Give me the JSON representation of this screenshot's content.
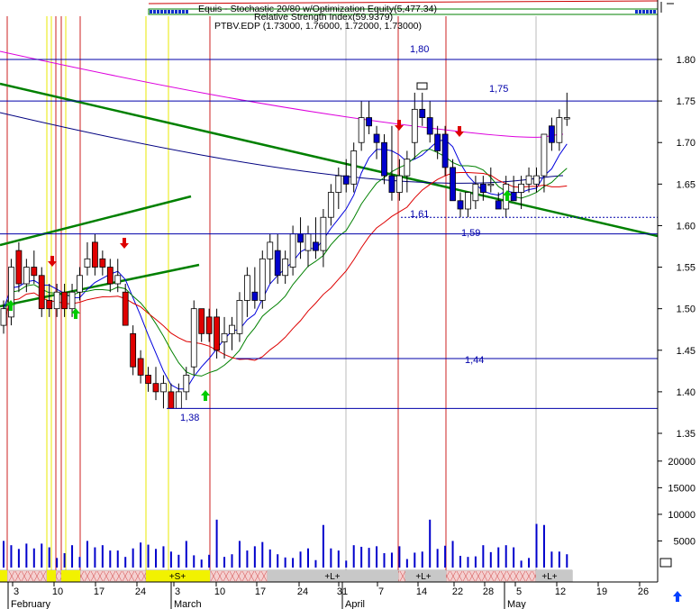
{
  "header": {
    "line1": "Equis - Stochastic 20/80 w/Optimization Equity(5,477.34)",
    "line2": "Relative Strength Index(59.9379)",
    "line3": "PTBV.EDP (1.73000, 1.76000, 1.72000, 1.73000)"
  },
  "colors": {
    "up_candle": "#ffffff",
    "down_candle_red": "#e00000",
    "down_candle_blue": "#0000cc",
    "volume": "#0000cc",
    "trendline": "#008000",
    "level": "#0000aa",
    "ma_magenta": "#dd00dd",
    "ma_navy": "#000080",
    "ma_green": "#008000",
    "ma_red": "#dd0000",
    "signal_line": "#cc0000",
    "buy_arrow": "#00cc00",
    "sell_arrow": "#dd0000"
  },
  "chart_data": {
    "type": "candlestick",
    "price_axis": {
      "ticks": [
        "1.80",
        "1.75",
        "1.70",
        "1.65",
        "1.60",
        "1.55",
        "1.50",
        "1.45",
        "1.40",
        "1.35"
      ],
      "ylim": [
        1.318,
        1.84
      ]
    },
    "volume_axis": {
      "ticks": [
        "20000",
        "15000",
        "10000",
        "5000"
      ],
      "ylim": [
        0,
        22000
      ]
    },
    "x_axis": {
      "tick_labels": [
        "3",
        "10",
        "17",
        "24",
        "3",
        "10",
        "17",
        "24",
        "31",
        "7",
        "14",
        "22",
        "28",
        "5",
        "12",
        "19",
        "26"
      ],
      "month_labels": [
        "February",
        "March",
        "April",
        "May"
      ]
    },
    "levels": [
      {
        "label": "1,80",
        "value": 1.8
      },
      {
        "label": "1,75",
        "value": 1.75
      },
      {
        "label": "1,61",
        "value": 1.61
      },
      {
        "label": "1,59",
        "value": 1.59
      },
      {
        "label": "1,44",
        "value": 1.44
      },
      {
        "label": "1,38",
        "value": 1.38
      }
    ],
    "candles": [
      {
        "o": 1.48,
        "h": 1.51,
        "l": 1.47,
        "c": 1.5
      },
      {
        "o": 1.49,
        "h": 1.56,
        "l": 1.48,
        "c": 1.55
      },
      {
        "o": 1.57,
        "h": 1.58,
        "l": 1.52,
        "c": 1.53
      },
      {
        "o": 1.53,
        "h": 1.56,
        "l": 1.52,
        "c": 1.55
      },
      {
        "o": 1.55,
        "h": 1.57,
        "l": 1.53,
        "c": 1.54
      },
      {
        "o": 1.54,
        "h": 1.55,
        "l": 1.49,
        "c": 1.5
      },
      {
        "o": 1.51,
        "h": 1.53,
        "l": 1.49,
        "c": 1.5
      },
      {
        "o": 1.5,
        "h": 1.53,
        "l": 1.49,
        "c": 1.52
      },
      {
        "o": 1.52,
        "h": 1.53,
        "l": 1.49,
        "c": 1.5
      },
      {
        "o": 1.5,
        "h": 1.53,
        "l": 1.49,
        "c": 1.52
      },
      {
        "o": 1.52,
        "h": 1.55,
        "l": 1.51,
        "c": 1.54
      },
      {
        "o": 1.55,
        "h": 1.58,
        "l": 1.54,
        "c": 1.56
      },
      {
        "o": 1.58,
        "h": 1.59,
        "l": 1.54,
        "c": 1.55
      },
      {
        "o": 1.56,
        "h": 1.57,
        "l": 1.54,
        "c": 1.55
      },
      {
        "o": 1.55,
        "h": 1.56,
        "l": 1.52,
        "c": 1.53
      },
      {
        "o": 1.53,
        "h": 1.56,
        "l": 1.52,
        "c": 1.54
      },
      {
        "o": 1.52,
        "h": 1.53,
        "l": 1.48,
        "c": 1.48
      },
      {
        "o": 1.47,
        "h": 1.48,
        "l": 1.42,
        "c": 1.43
      },
      {
        "o": 1.44,
        "h": 1.45,
        "l": 1.41,
        "c": 1.42
      },
      {
        "o": 1.42,
        "h": 1.43,
        "l": 1.4,
        "c": 1.41
      },
      {
        "o": 1.41,
        "h": 1.43,
        "l": 1.39,
        "c": 1.4
      },
      {
        "o": 1.4,
        "h": 1.42,
        "l": 1.38,
        "c": 1.41
      },
      {
        "o": 1.4,
        "h": 1.41,
        "l": 1.38,
        "c": 1.38
      },
      {
        "o": 1.38,
        "h": 1.41,
        "l": 1.38,
        "c": 1.4
      },
      {
        "o": 1.4,
        "h": 1.43,
        "l": 1.39,
        "c": 1.42
      },
      {
        "o": 1.43,
        "h": 1.51,
        "l": 1.42,
        "c": 1.5
      },
      {
        "o": 1.5,
        "h": 1.5,
        "l": 1.46,
        "c": 1.47
      },
      {
        "o": 1.49,
        "h": 1.5,
        "l": 1.46,
        "c": 1.47
      },
      {
        "o": 1.49,
        "h": 1.5,
        "l": 1.44,
        "c": 1.45
      },
      {
        "o": 1.46,
        "h": 1.49,
        "l": 1.44,
        "c": 1.47
      },
      {
        "o": 1.47,
        "h": 1.49,
        "l": 1.45,
        "c": 1.48
      },
      {
        "o": 1.47,
        "h": 1.52,
        "l": 1.46,
        "c": 1.51
      },
      {
        "o": 1.51,
        "h": 1.55,
        "l": 1.49,
        "c": 1.54
      },
      {
        "o": 1.52,
        "h": 1.55,
        "l": 1.5,
        "c": 1.51
      },
      {
        "o": 1.51,
        "h": 1.57,
        "l": 1.5,
        "c": 1.56
      },
      {
        "o": 1.56,
        "h": 1.59,
        "l": 1.53,
        "c": 1.58
      },
      {
        "o": 1.57,
        "h": 1.59,
        "l": 1.53,
        "c": 1.54
      },
      {
        "o": 1.54,
        "h": 1.57,
        "l": 1.53,
        "c": 1.56
      },
      {
        "o": 1.55,
        "h": 1.6,
        "l": 1.54,
        "c": 1.59
      },
      {
        "o": 1.59,
        "h": 1.61,
        "l": 1.56,
        "c": 1.58
      },
      {
        "o": 1.57,
        "h": 1.6,
        "l": 1.55,
        "c": 1.59
      },
      {
        "o": 1.58,
        "h": 1.61,
        "l": 1.56,
        "c": 1.57
      },
      {
        "o": 1.57,
        "h": 1.62,
        "l": 1.55,
        "c": 1.61
      },
      {
        "o": 1.61,
        "h": 1.65,
        "l": 1.6,
        "c": 1.64
      },
      {
        "o": 1.64,
        "h": 1.67,
        "l": 1.62,
        "c": 1.66
      },
      {
        "o": 1.66,
        "h": 1.68,
        "l": 1.64,
        "c": 1.65
      },
      {
        "o": 1.65,
        "h": 1.7,
        "l": 1.64,
        "c": 1.69
      },
      {
        "o": 1.7,
        "h": 1.75,
        "l": 1.69,
        "c": 1.73
      },
      {
        "o": 1.73,
        "h": 1.75,
        "l": 1.71,
        "c": 1.72
      },
      {
        "o": 1.71,
        "h": 1.72,
        "l": 1.68,
        "c": 1.7
      },
      {
        "o": 1.7,
        "h": 1.71,
        "l": 1.65,
        "c": 1.66
      },
      {
        "o": 1.66,
        "h": 1.72,
        "l": 1.63,
        "c": 1.64
      },
      {
        "o": 1.64,
        "h": 1.68,
        "l": 1.63,
        "c": 1.66
      },
      {
        "o": 1.66,
        "h": 1.69,
        "l": 1.64,
        "c": 1.68
      },
      {
        "o": 1.7,
        "h": 1.76,
        "l": 1.68,
        "c": 1.74
      },
      {
        "o": 1.74,
        "h": 1.76,
        "l": 1.72,
        "c": 1.73
      },
      {
        "o": 1.73,
        "h": 1.75,
        "l": 1.7,
        "c": 1.71
      },
      {
        "o": 1.71,
        "h": 1.72,
        "l": 1.68,
        "c": 1.69
      },
      {
        "o": 1.71,
        "h": 1.72,
        "l": 1.66,
        "c": 1.67
      },
      {
        "o": 1.67,
        "h": 1.68,
        "l": 1.63,
        "c": 1.63
      },
      {
        "o": 1.63,
        "h": 1.64,
        "l": 1.61,
        "c": 1.62
      },
      {
        "o": 1.62,
        "h": 1.64,
        "l": 1.61,
        "c": 1.64
      },
      {
        "o": 1.63,
        "h": 1.66,
        "l": 1.62,
        "c": 1.65
      },
      {
        "o": 1.65,
        "h": 1.66,
        "l": 1.63,
        "c": 1.64
      },
      {
        "o": 1.65,
        "h": 1.67,
        "l": 1.64,
        "c": 1.65
      },
      {
        "o": 1.63,
        "h": 1.64,
        "l": 1.62,
        "c": 1.62
      },
      {
        "o": 1.62,
        "h": 1.66,
        "l": 1.61,
        "c": 1.65
      },
      {
        "o": 1.64,
        "h": 1.66,
        "l": 1.63,
        "c": 1.63
      },
      {
        "o": 1.64,
        "h": 1.66,
        "l": 1.62,
        "c": 1.65
      },
      {
        "o": 1.65,
        "h": 1.67,
        "l": 1.64,
        "c": 1.66
      },
      {
        "o": 1.65,
        "h": 1.67,
        "l": 1.64,
        "c": 1.66
      },
      {
        "o": 1.66,
        "h": 1.71,
        "l": 1.64,
        "c": 1.71
      },
      {
        "o": 1.72,
        "h": 1.73,
        "l": 1.69,
        "c": 1.7
      },
      {
        "o": 1.7,
        "h": 1.74,
        "l": 1.69,
        "c": 1.73
      },
      {
        "o": 1.73,
        "h": 1.76,
        "l": 1.72,
        "c": 1.73
      }
    ],
    "volume": [
      5000,
      4200,
      3500,
      4500,
      3600,
      4500,
      3800,
      1800,
      2700,
      4200,
      2000,
      5000,
      3800,
      4200,
      3200,
      3200,
      2000,
      3600,
      4700,
      4300,
      3500,
      4000,
      3000,
      2400,
      5000,
      2300,
      1500,
      2400,
      9000,
      2000,
      2500,
      5000,
      3200,
      4000,
      4800,
      3400,
      2500,
      1900,
      1800,
      3000,
      3600,
      1400,
      8000,
      3600,
      3200,
      1300,
      4200,
      3900,
      3700,
      4000,
      2700,
      2800,
      4000,
      1600,
      2800,
      3000,
      9000,
      3500,
      4100,
      5000,
      2200,
      2000,
      2100,
      4200,
      2900,
      3800,
      4200,
      3800,
      1300,
      1800,
      8200,
      8000,
      3000,
      3000,
      2500
    ]
  },
  "bands": {
    "labels": [
      "+S+",
      "+L+",
      "+L+",
      "+L+"
    ]
  }
}
